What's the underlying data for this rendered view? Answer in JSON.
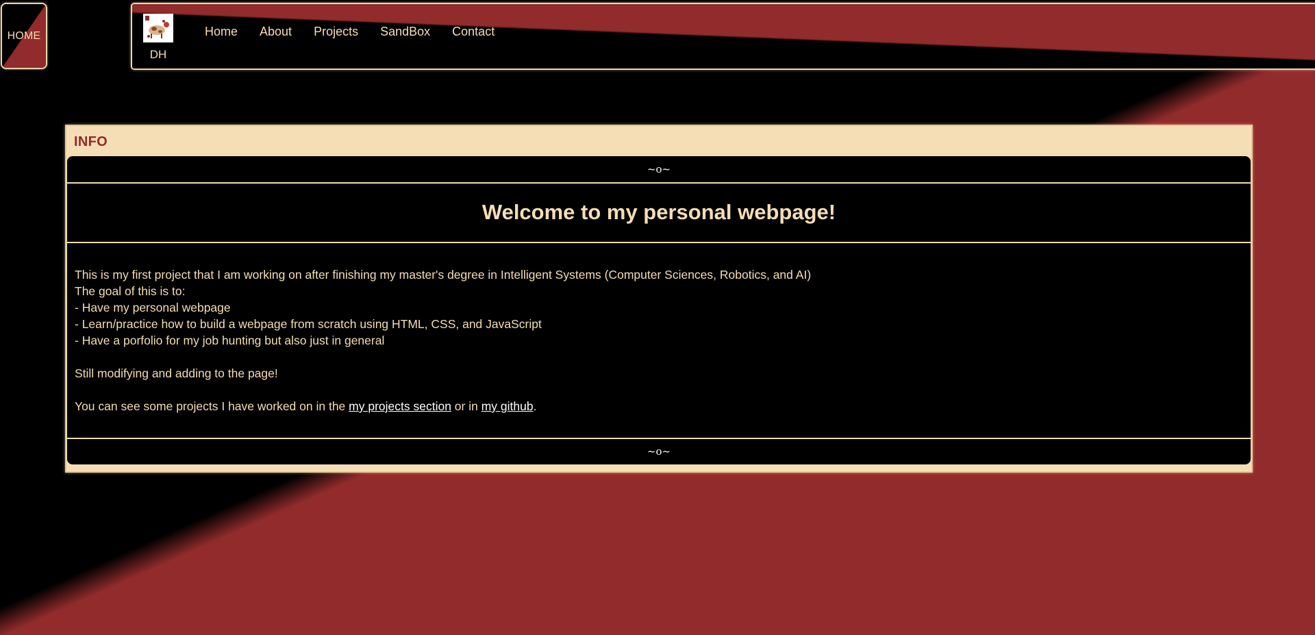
{
  "home_button": {
    "label": "HOME"
  },
  "nav": {
    "logo_text": "DH",
    "links": [
      {
        "label": "Home"
      },
      {
        "label": "About"
      },
      {
        "label": "Projects"
      },
      {
        "label": "SandBox"
      },
      {
        "label": "Contact"
      }
    ]
  },
  "info_panel": {
    "title": "INFO",
    "divider_top": "~o~",
    "divider_bottom": "~o~",
    "heading": "Welcome to my personal webpage!",
    "lines": [
      "This is my first project that I am working on after finishing my master's degree in Intelligent Systems (Computer Sciences, Robotics, and AI)",
      "The goal of this is to:",
      "- Have my personal webpage",
      "- Learn/practice how to build a webpage from scratch using HTML, CSS, and JavaScript",
      "- Have a porfolio for my job hunting but also just in general"
    ],
    "still_modifying": "Still modifying and adding to the page!",
    "projects_line": {
      "prefix": "You can see some projects I have worked on in the ",
      "projects_link": "my projects section",
      "middle": " or in ",
      "github_link": "my github",
      "suffix": "."
    }
  },
  "colors": {
    "accent_red": "#922b2b",
    "cream": "#f5ddb5",
    "black": "#000000"
  }
}
